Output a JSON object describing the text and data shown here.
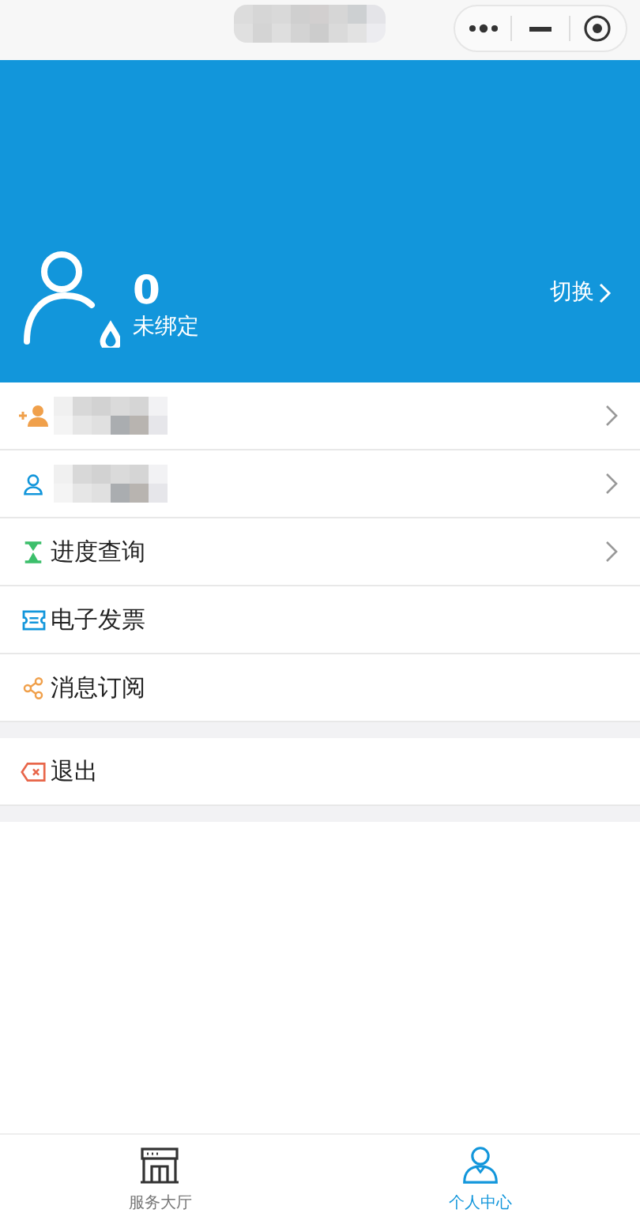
{
  "top_bar": {
    "title_redacted": true
  },
  "header": {
    "count": "0",
    "status": "未绑定",
    "switch_label": "切换"
  },
  "menu_groups": [
    {
      "items": [
        {
          "kind": "add-user",
          "label_redacted": true,
          "has_arrow": true
        },
        {
          "kind": "user",
          "label_redacted": true,
          "has_arrow": true
        },
        {
          "kind": "progress",
          "label": "进度查询",
          "has_arrow": true
        },
        {
          "kind": "invoice",
          "label": "电子发票",
          "has_arrow": false
        },
        {
          "kind": "subscribe",
          "label": "消息订阅",
          "has_arrow": false
        }
      ]
    },
    {
      "items": [
        {
          "kind": "logout",
          "label": "退出",
          "has_arrow": false
        }
      ]
    }
  ],
  "tab_bar": [
    {
      "kind": "hall",
      "label": "服务大厅",
      "selected": false
    },
    {
      "kind": "personal",
      "label": "个人中心",
      "selected": true
    }
  ]
}
